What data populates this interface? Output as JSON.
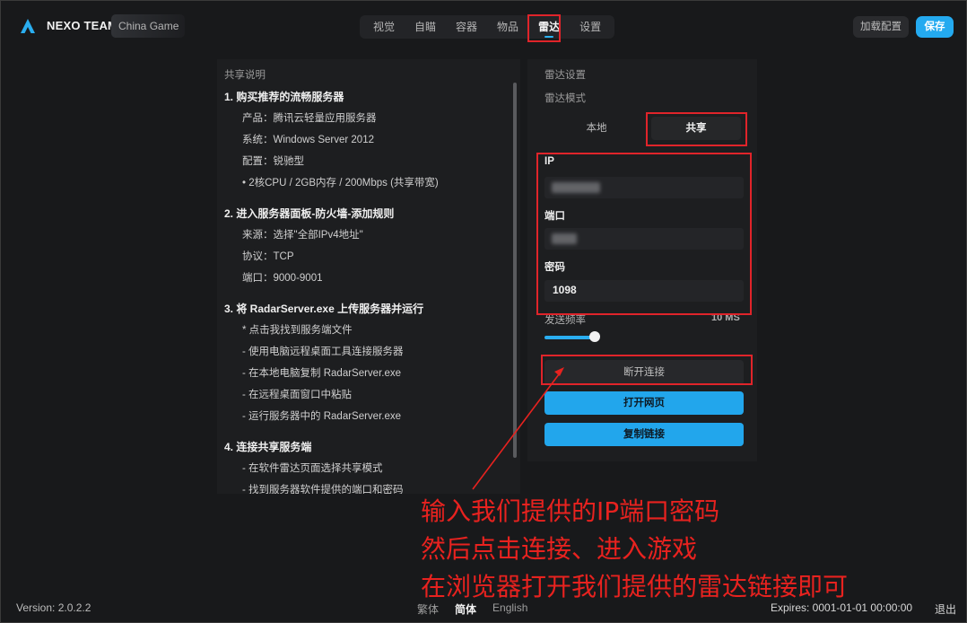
{
  "header": {
    "brand": "NEXO TEAM",
    "game": "China Game",
    "tabs": [
      "视觉",
      "自瞄",
      "容器",
      "物品",
      "雷达",
      "设置"
    ],
    "active_tab": "雷达",
    "load_config_label": "加载配置",
    "save_label": "保存"
  },
  "guide": {
    "title": "共享说明",
    "sections": [
      {
        "heading": "1. 购买推荐的流畅服务器",
        "lines": [
          "产品：腾讯云轻量应用服务器",
          "系统：Windows Server 2012",
          "配置：锐驰型",
          "• 2核CPU / 2GB内存 / 200Mbps (共享带宽)"
        ]
      },
      {
        "heading": "2. 进入服务器面板-防火墙-添加规则",
        "lines": [
          "来源：选择\"全部IPv4地址\"",
          "协议：TCP",
          "端口：9000-9001"
        ]
      },
      {
        "heading": "3. 将 RadarServer.exe 上传服务器并运行",
        "lines": [
          "* 点击我找到服务端文件",
          "- 使用电脑远程桌面工具连接服务器",
          "- 在本地电脑复制 RadarServer.exe",
          "- 在远程桌面窗口中粘贴",
          "- 运行服务器中的 RadarServer.exe"
        ]
      },
      {
        "heading": "4. 连接共享服务端",
        "lines": [
          "- 在软件雷达页面选择共享模式",
          "- 找到服务器软件提供的端口和密码"
        ]
      }
    ]
  },
  "radar": {
    "title": "雷达设置",
    "mode_label": "雷达模式",
    "mode_local": "本地",
    "mode_share": "共享",
    "ip_label": "IP",
    "port_label": "端口",
    "password_label": "密码",
    "password_value": "1098",
    "freq_label": "发送频率",
    "freq_value": "10 MS",
    "freq_level": 0.25,
    "disconnect_label": "断开连接",
    "open_web_label": "打开网页",
    "copy_link_label": "复制链接"
  },
  "annotation": {
    "lines": [
      "输入我们提供的IP端口密码",
      "然后点击连接、进入游戏",
      "在浏览器打开我们提供的雷达链接即可"
    ],
    "color": "#e8221f"
  },
  "footer": {
    "version": "Version: 2.0.2.2",
    "languages": [
      "繁体",
      "简体",
      "English"
    ],
    "active_language": "简体",
    "expires": "Expires: 0001-01-01 00:00:00",
    "logout": "退出"
  },
  "colors": {
    "accent": "#24aaf0",
    "background": "#18191b",
    "highlight": "#e0242a"
  }
}
